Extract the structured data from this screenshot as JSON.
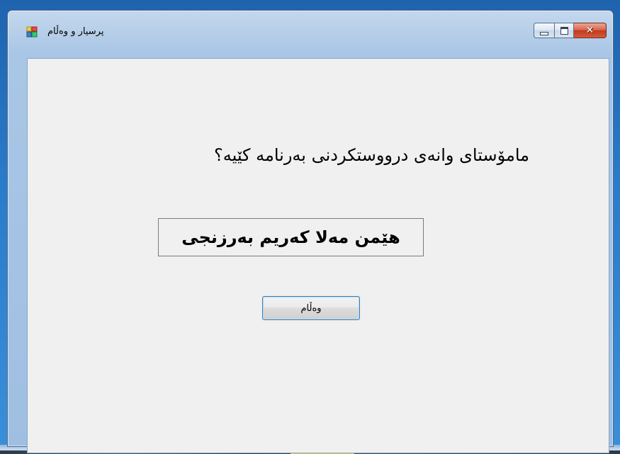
{
  "window": {
    "title": "پرسیار و وەڵام",
    "icon": "form-app-icon",
    "caption_buttons": {
      "minimize": "minimize-icon",
      "maximize": "maximize-icon",
      "close": "close-icon",
      "close_glyph": "✕"
    }
  },
  "form": {
    "question": "مامۆستای وانەی درووستکردنی بەرنامە کێیە؟",
    "answer": "هێمن مەلا کەریم بەرزنجی",
    "button_label": "وەڵام"
  },
  "colors": {
    "close_button": "#c23b20",
    "client_background": "#f0f0f0",
    "desktop": "#2a7bc9"
  }
}
